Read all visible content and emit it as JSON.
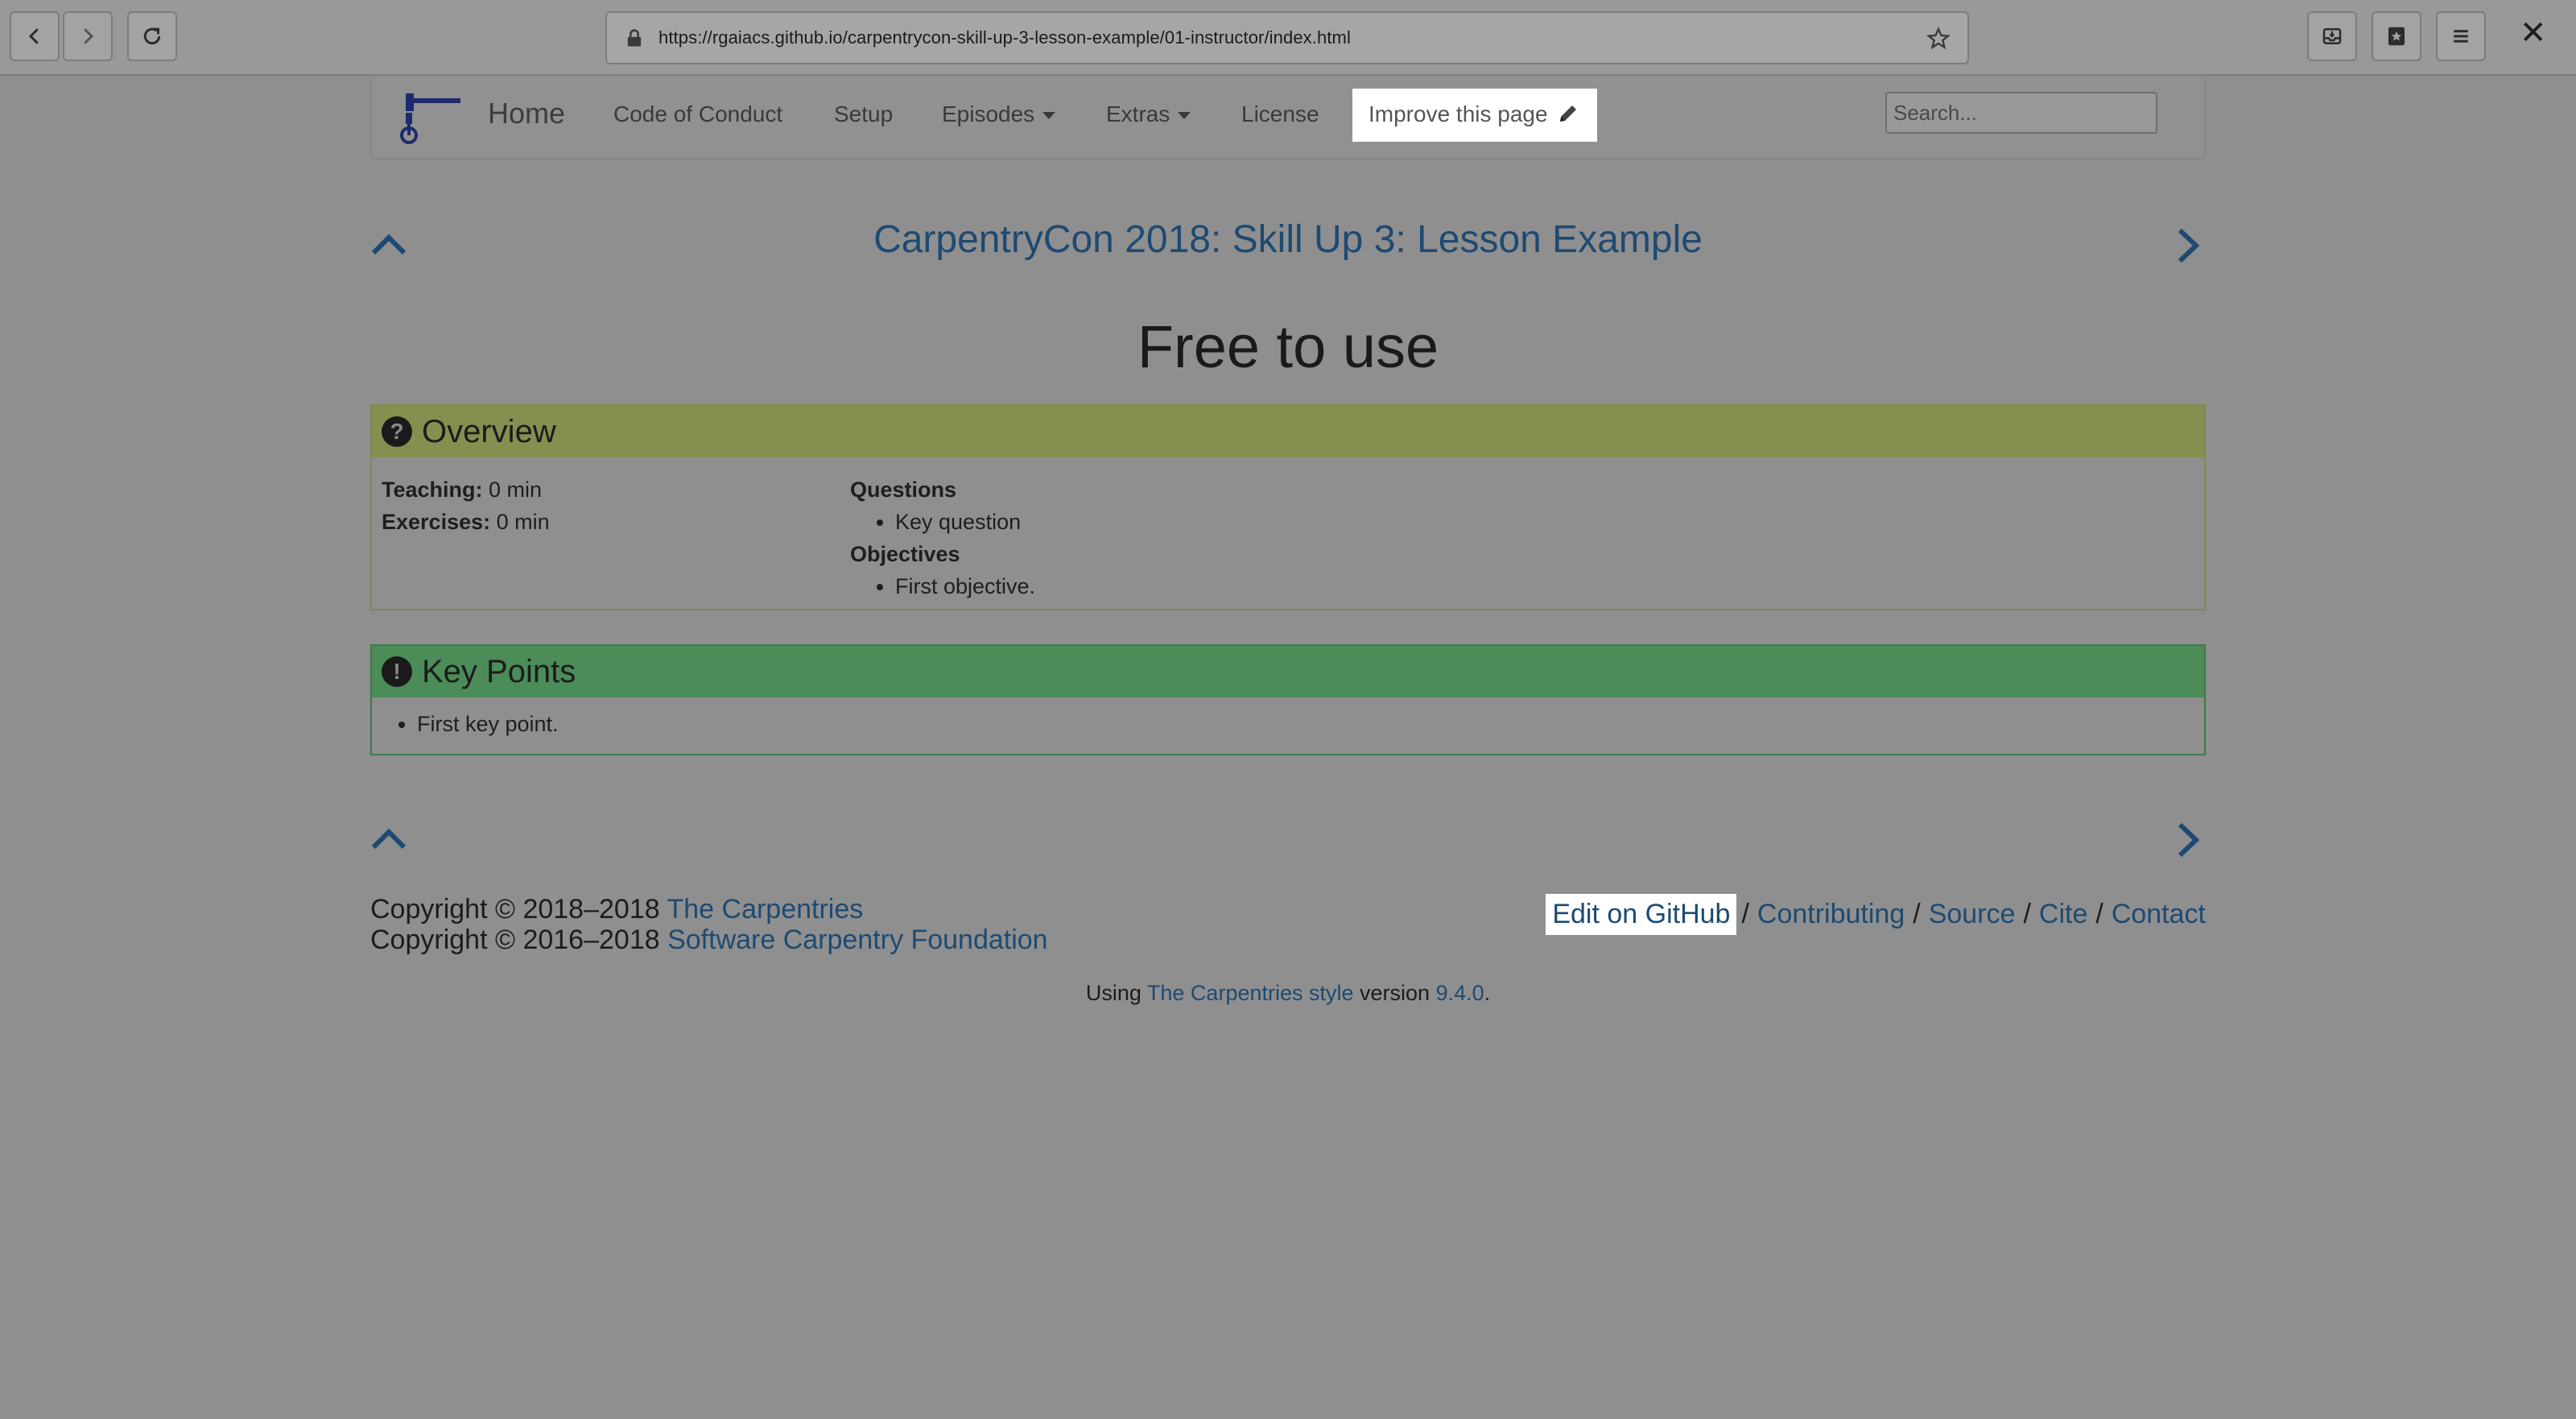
{
  "browser": {
    "url": "https://rgaiacs.github.io/carpentrycon-skill-up-3-lesson-example/01-instructor/index.html",
    "close_label": "✕"
  },
  "navbar": {
    "home": "Home",
    "items": [
      "Code of Conduct",
      "Setup",
      "Episodes",
      "Extras",
      "License"
    ],
    "improve": "Improve this page",
    "search_placeholder": "Search..."
  },
  "lesson_title": "CarpentryCon 2018: Skill Up 3: Lesson Example",
  "page_title": "Free to use",
  "overview": {
    "title": "Overview",
    "teaching_label": "Teaching:",
    "teaching_value": "0 min",
    "exercises_label": "Exercises:",
    "exercises_value": "0 min",
    "questions_label": "Questions",
    "questions": [
      "Key question"
    ],
    "objectives_label": "Objectives",
    "objectives": [
      "First objective."
    ]
  },
  "keypoints": {
    "title": "Key Points",
    "items": [
      "First key point."
    ]
  },
  "footer": {
    "copyright1": "Copyright © 2018–2018 ",
    "copyright1_link": "The Carpentries",
    "copyright2": "Copyright © 2016–2018 ",
    "copyright2_link": "Software Carpentry Foundation",
    "links": [
      "Edit on GitHub",
      "Contributing",
      "Source",
      "Cite",
      "Contact"
    ],
    "using_prefix": "Using ",
    "using_link": "The Carpentries style",
    "using_mid": " version ",
    "using_version": "9.4.0",
    "using_suffix": "."
  }
}
